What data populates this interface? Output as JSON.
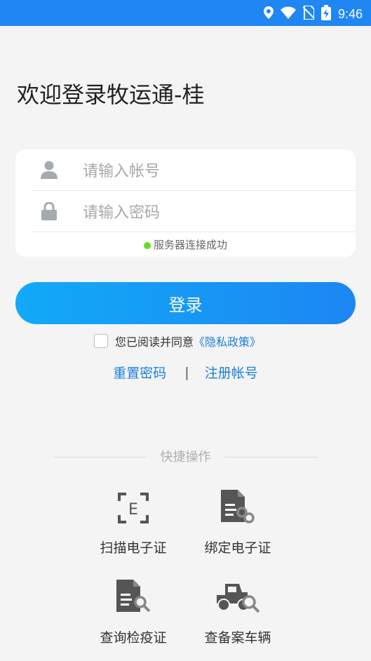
{
  "status_bar": {
    "time": "9:46",
    "icons": [
      "location-icon",
      "wifi-icon",
      "no-sim-icon",
      "battery-charging-icon"
    ]
  },
  "page": {
    "title": "欢迎登录牧运通-桂"
  },
  "login_form": {
    "account_placeholder": "请输入帐号",
    "password_placeholder": "请输入密码",
    "server_status": "服务器连接成功",
    "server_status_color": "#66dd22"
  },
  "login_button": {
    "label": "登录",
    "gradient": [
      "#12aaf8",
      "#1c86f2"
    ]
  },
  "agreement": {
    "checked": false,
    "text": "您已阅读并同意",
    "policy_link": "《隐私政策》"
  },
  "links": {
    "reset_password": "重置密码",
    "separator": "|",
    "register": "注册帐号"
  },
  "quick_actions": {
    "title": "快捷操作",
    "items": [
      {
        "label": "扫描电子证",
        "icon": "scan-certificate-icon"
      },
      {
        "label": "绑定电子证",
        "icon": "bind-certificate-icon"
      },
      {
        "label": "查询检疫证",
        "icon": "search-quarantine-icon"
      },
      {
        "label": "查备案车辆",
        "icon": "search-vehicle-icon"
      }
    ]
  },
  "colors": {
    "status_bar": "#1f86f3",
    "link": "#1a7fd6",
    "background": "#f4f4f4"
  }
}
